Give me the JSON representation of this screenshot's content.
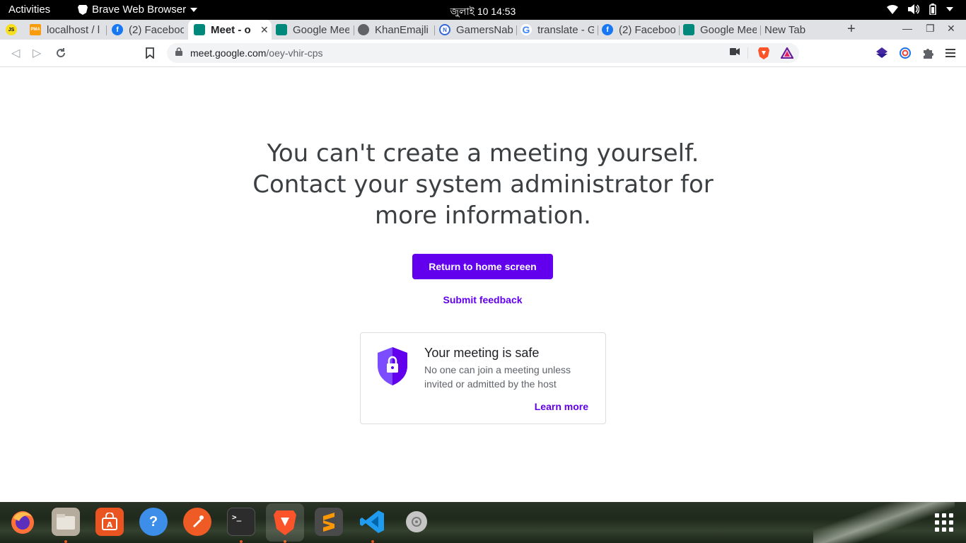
{
  "topbar": {
    "activities": "Activities",
    "app_name": "Brave Web Browser",
    "clock": "জুলাই 10  14:53"
  },
  "tabs": [
    {
      "title": "",
      "favicon": "js-icon",
      "color": "#f7df1e"
    },
    {
      "title": "localhost / l",
      "favicon": "phpmyadmin-icon",
      "color": "#f89c0e"
    },
    {
      "title": "(2) Faceboo",
      "favicon": "facebook-icon",
      "color": "#1877f2"
    },
    {
      "title": "Meet - o",
      "favicon": "google-meet-icon",
      "color": "#00897b",
      "active": true
    },
    {
      "title": "Google Mee",
      "favicon": "google-meet-icon",
      "color": "#00897b"
    },
    {
      "title": "KhanEmajli",
      "favicon": "globe-icon",
      "color": "#5f6368"
    },
    {
      "title": "GamersNab",
      "favicon": "gamersnab-icon",
      "color": "#3367d6"
    },
    {
      "title": "translate - G",
      "favicon": "google-icon",
      "color": "#4285f4"
    },
    {
      "title": "(2) Faceboo",
      "favicon": "facebook-icon",
      "color": "#1877f2"
    },
    {
      "title": "Google Mee",
      "favicon": "google-meet-icon",
      "color": "#00897b"
    },
    {
      "title": "New Tab",
      "favicon": "",
      "color": ""
    }
  ],
  "toolbar": {
    "url_host": "meet.google.com",
    "url_path": "/oey-vhir-cps"
  },
  "main": {
    "headline": "You can't create a meeting yourself. Contact your system administrator for more information.",
    "primary_button": "Return to home screen",
    "feedback_link": "Submit feedback",
    "card": {
      "title": "Your meeting is safe",
      "body": "No one can join a meeting unless invited or admitted by the host",
      "link": "Learn more"
    }
  },
  "dock": {
    "apps": [
      "firefox-icon",
      "files-icon",
      "software-center-icon",
      "help-icon",
      "postman-icon",
      "terminal-icon",
      "brave-icon",
      "sublime-text-icon",
      "vscode-icon",
      "disk-icon"
    ]
  },
  "colors": {
    "accent": "#6200ee",
    "tabstrip": "#dfe1e5"
  }
}
